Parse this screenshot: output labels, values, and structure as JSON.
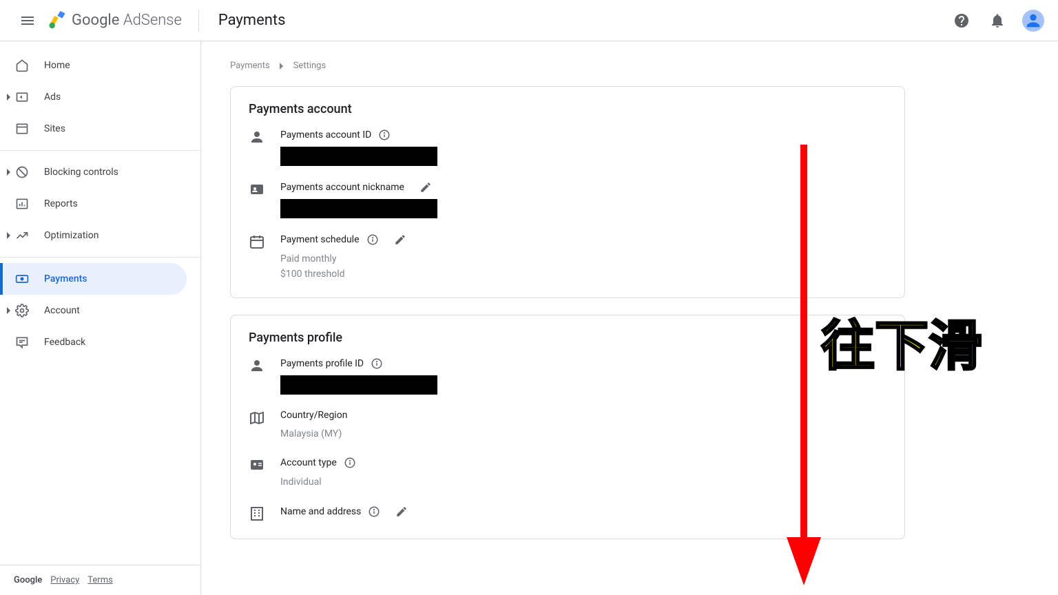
{
  "header": {
    "brand_google": "Google",
    "brand_adsense": " AdSense",
    "page_title": "Payments"
  },
  "sidebar": {
    "items": [
      {
        "label": "Home",
        "expandable": false
      },
      {
        "label": "Ads",
        "expandable": true
      },
      {
        "label": "Sites",
        "expandable": false
      },
      {
        "label": "Blocking controls",
        "expandable": true
      },
      {
        "label": "Reports",
        "expandable": false
      },
      {
        "label": "Optimization",
        "expandable": true
      },
      {
        "label": "Payments",
        "expandable": false
      },
      {
        "label": "Account",
        "expandable": true
      },
      {
        "label": "Feedback",
        "expandable": false
      }
    ],
    "footer": {
      "google": "Google",
      "privacy": "Privacy",
      "terms": "Terms"
    }
  },
  "breadcrumb": {
    "root": "Payments",
    "child": "Settings"
  },
  "cards": {
    "account": {
      "title": "Payments account",
      "id_label": "Payments account ID",
      "nickname_label": "Payments account nickname",
      "schedule_label": "Payment schedule",
      "schedule_line1": "Paid monthly",
      "schedule_line2": "$100 threshold"
    },
    "profile": {
      "title": "Payments profile",
      "id_label": "Payments profile ID",
      "country_label": "Country/Region",
      "country_value": "Malaysia (MY)",
      "type_label": "Account type",
      "type_value": "Individual",
      "name_label": "Name and address"
    }
  },
  "annotation": {
    "text": "往下滑"
  }
}
